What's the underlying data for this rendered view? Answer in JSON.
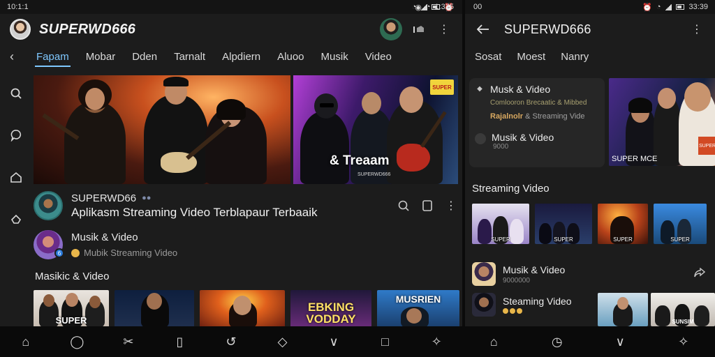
{
  "status_left": {
    "time": "10:1:1"
  },
  "status_mid": {
    "time": "1:325"
  },
  "status_right": {
    "left": "00",
    "time": "33:39"
  },
  "left": {
    "app_title": "SUPERWD666",
    "tabs": [
      {
        "label": "Fapam",
        "active": true
      },
      {
        "label": "Mobar",
        "active": false
      },
      {
        "label": "Dden",
        "active": false
      },
      {
        "label": "Tarnalt",
        "active": false
      },
      {
        "label": "Alpdiern",
        "active": false
      },
      {
        "label": "Aluoo",
        "active": false
      },
      {
        "label": "Musik",
        "active": false
      },
      {
        "label": "Video",
        "active": false
      }
    ],
    "banner": {
      "caption": "& Treaam",
      "sub": "SUPERWD666",
      "badge": "SUPER"
    },
    "channel": {
      "name": "SUPERWD66",
      "dots": "●●",
      "description": "Aplikasm Streaming Video Terblapaur Terbaaik"
    },
    "row2": {
      "title": "Musik & Video",
      "sub": "Mubik Streaming Video"
    },
    "section_title": "Masikic & Video",
    "thumbs": [
      {
        "label": "SUPER"
      },
      {
        "label": ""
      },
      {
        "label": ""
      },
      {
        "label": "EBKING VODDAY"
      },
      {
        "label": "MUSRIEN"
      }
    ]
  },
  "right": {
    "title": "SUPERWD666",
    "tabs": [
      "Sosat",
      "Moest",
      "Nanry"
    ],
    "card": {
      "title1": "Musk & Video",
      "line1": "Comlooron Brecaatic & Mibbed",
      "line2_highlight": "Rajalnolr",
      "line2_rest": " & Streaming Vide",
      "title2": "Musik & Video",
      "sub2": "9000"
    },
    "feature": {
      "caption": "SUPER MCE",
      "badge": "SUPER"
    },
    "section_title": "Streaming Video",
    "thumbs": [
      {
        "label": "SUPER"
      },
      {
        "label": "SUPER"
      },
      {
        "label": "SUPER"
      },
      {
        "label": "SUPER"
      }
    ],
    "list": [
      {
        "title": "Musik & Video",
        "sub": "9000000"
      },
      {
        "title": "Steaming Video",
        "sub": ""
      }
    ],
    "list_thumb_label": "SUNSIM"
  }
}
